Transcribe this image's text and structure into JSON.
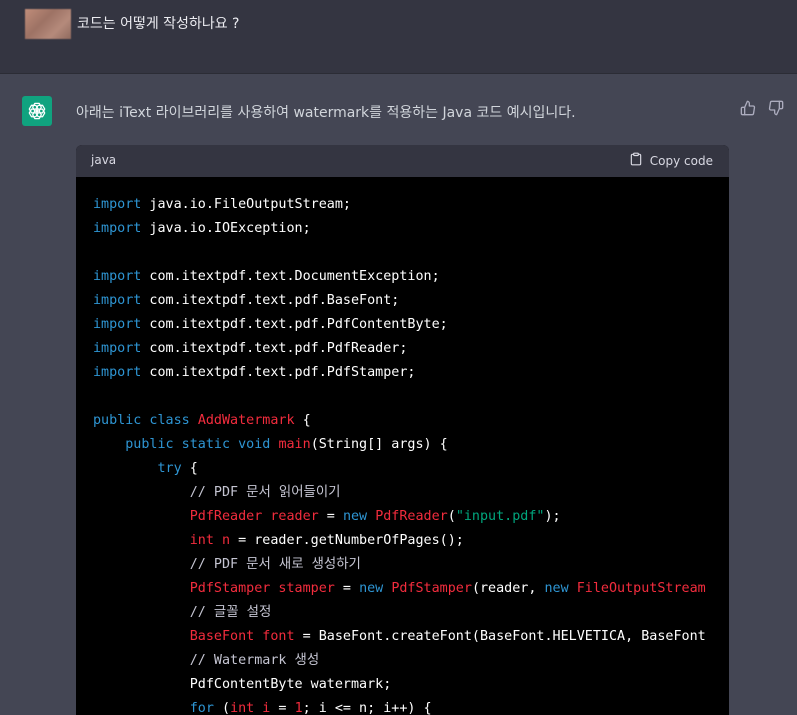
{
  "user_message": {
    "text": "코드는 어떻게 작성하나요 ?"
  },
  "assistant_message": {
    "text": "아래는 iText 라이브러리를 사용하여 watermark를 적용하는 Java 코드 예시입니다.",
    "feedback": {
      "thumbs_up_icon": "thumbs-up-icon",
      "thumbs_down_icon": "thumbs-down-icon"
    }
  },
  "code_block": {
    "language": "java",
    "copy_label": "Copy code",
    "lines": [
      [
        {
          "t": "import",
          "c": "kw"
        },
        {
          "t": " java.io.FileOutputStream;",
          "c": "pl"
        }
      ],
      [
        {
          "t": "import",
          "c": "kw"
        },
        {
          "t": " java.io.IOException;",
          "c": "pl"
        }
      ],
      [],
      [
        {
          "t": "import",
          "c": "kw"
        },
        {
          "t": " com.itextpdf.text.DocumentException;",
          "c": "pl"
        }
      ],
      [
        {
          "t": "import",
          "c": "kw"
        },
        {
          "t": " com.itextpdf.text.pdf.BaseFont;",
          "c": "pl"
        }
      ],
      [
        {
          "t": "import",
          "c": "kw"
        },
        {
          "t": " com.itextpdf.text.pdf.PdfContentByte;",
          "c": "pl"
        }
      ],
      [
        {
          "t": "import",
          "c": "kw"
        },
        {
          "t": " com.itextpdf.text.pdf.PdfReader;",
          "c": "pl"
        }
      ],
      [
        {
          "t": "import",
          "c": "kw"
        },
        {
          "t": " com.itextpdf.text.pdf.PdfStamper;",
          "c": "pl"
        }
      ],
      [],
      [
        {
          "t": "public class ",
          "c": "kw"
        },
        {
          "t": "AddWatermark",
          "c": "cls"
        },
        {
          "t": " {",
          "c": "pl"
        }
      ],
      [
        {
          "t": "    ",
          "c": "pl"
        },
        {
          "t": "public static void ",
          "c": "kw"
        },
        {
          "t": "main",
          "c": "cls"
        },
        {
          "t": "(String[] args) {",
          "c": "pl"
        }
      ],
      [
        {
          "t": "        ",
          "c": "pl"
        },
        {
          "t": "try",
          "c": "kw"
        },
        {
          "t": " {",
          "c": "pl"
        }
      ],
      [
        {
          "t": "            ",
          "c": "pl"
        },
        {
          "t": "// PDF 문서 읽어들이기",
          "c": "cm"
        }
      ],
      [
        {
          "t": "            ",
          "c": "pl"
        },
        {
          "t": "PdfReader reader",
          "c": "cls"
        },
        {
          "t": " = ",
          "c": "pl"
        },
        {
          "t": "new ",
          "c": "kw"
        },
        {
          "t": "PdfReader",
          "c": "cls"
        },
        {
          "t": "(",
          "c": "pl"
        },
        {
          "t": "\"input.pdf\"",
          "c": "str"
        },
        {
          "t": ");",
          "c": "pl"
        }
      ],
      [
        {
          "t": "            ",
          "c": "pl"
        },
        {
          "t": "int n",
          "c": "cls"
        },
        {
          "t": " = reader.getNumberOfPages();",
          "c": "pl"
        }
      ],
      [
        {
          "t": "            ",
          "c": "pl"
        },
        {
          "t": "// PDF 문서 새로 생성하기",
          "c": "cm"
        }
      ],
      [
        {
          "t": "            ",
          "c": "pl"
        },
        {
          "t": "PdfStamper stamper",
          "c": "cls"
        },
        {
          "t": " = ",
          "c": "pl"
        },
        {
          "t": "new ",
          "c": "kw"
        },
        {
          "t": "PdfStamper",
          "c": "cls"
        },
        {
          "t": "(reader, ",
          "c": "pl"
        },
        {
          "t": "new ",
          "c": "kw"
        },
        {
          "t": "FileOutputStream",
          "c": "cls"
        }
      ],
      [
        {
          "t": "            ",
          "c": "pl"
        },
        {
          "t": "// 글꼴 설정",
          "c": "cm"
        }
      ],
      [
        {
          "t": "            ",
          "c": "pl"
        },
        {
          "t": "BaseFont font",
          "c": "cls"
        },
        {
          "t": " = BaseFont.createFont(BaseFont.HELVETICA, BaseFont",
          "c": "pl"
        }
      ],
      [
        {
          "t": "            ",
          "c": "pl"
        },
        {
          "t": "// Watermark 생성",
          "c": "cm"
        }
      ],
      [
        {
          "t": "            PdfContentByte watermark;",
          "c": "pl"
        }
      ],
      [
        {
          "t": "            ",
          "c": "pl"
        },
        {
          "t": "for",
          "c": "kw"
        },
        {
          "t": " (",
          "c": "pl"
        },
        {
          "t": "int i",
          "c": "cls"
        },
        {
          "t": " = ",
          "c": "pl"
        },
        {
          "t": "1",
          "c": "cls"
        },
        {
          "t": "; i <= n; i++) {",
          "c": "pl"
        }
      ]
    ]
  },
  "colors": {
    "page_bg": "#444654",
    "user_bg": "#343541",
    "code_bg": "#000000",
    "keyword": "#2e95d3",
    "class_name": "#f22c3d",
    "string": "#00a67d",
    "comment": "#c5c5d2",
    "gpt_brand": "#10a37f"
  }
}
